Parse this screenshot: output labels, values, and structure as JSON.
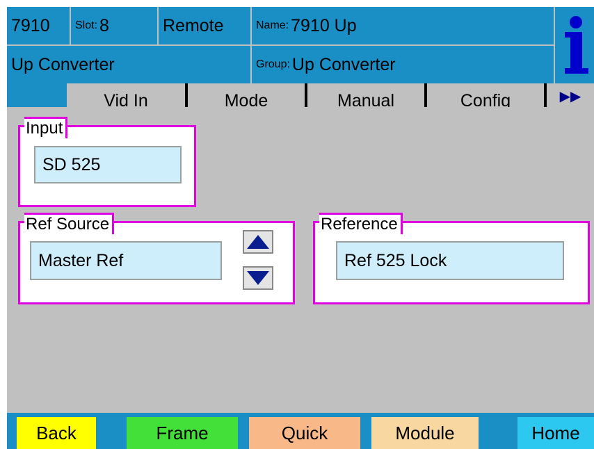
{
  "header": {
    "model": "7910",
    "slot_label": "Slot:",
    "slot_value": "8",
    "mode": "Remote",
    "name_label": "Name:",
    "name_value": "7910 Up",
    "device_type": "Up Converter",
    "group_label": "Group:",
    "group_value": "Up Converter",
    "info_icon": "info-icon"
  },
  "tabs": [
    {
      "label": "Vid In"
    },
    {
      "label": "Mode"
    },
    {
      "label": "Manual"
    },
    {
      "label": "Config"
    },
    {
      "label": "▶▶"
    }
  ],
  "input_group": {
    "title": "Input",
    "value": "SD 525"
  },
  "ref_source_group": {
    "title": "Ref Source",
    "value": "Master Ref",
    "up_icon": "arrow-up-icon",
    "down_icon": "arrow-down-icon"
  },
  "reference_group": {
    "title": "Reference",
    "value": "Ref 525 Lock"
  },
  "bottom_buttons": [
    {
      "label": "Back",
      "color": "#ffff00"
    },
    {
      "label": "Frame",
      "color": "#44e03a"
    },
    {
      "label": "Quick",
      "color": "#f8b888"
    },
    {
      "label": "Module",
      "color": "#f8d8a0"
    },
    {
      "label": "Home",
      "color": "#2cc8f0"
    }
  ],
  "colors": {
    "header_blue": "#1a8fc6",
    "group_border": "#e000e0",
    "field_bg": "#cfeefb",
    "panel_bg": "#c0c0c0"
  }
}
